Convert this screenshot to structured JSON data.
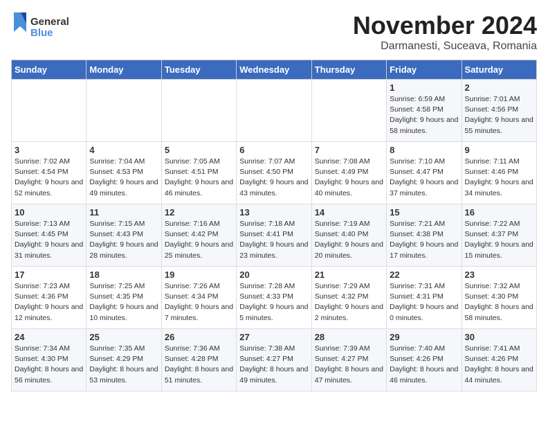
{
  "logo": {
    "line1": "General",
    "line2": "Blue"
  },
  "title": "November 2024",
  "location": "Darmanesti, Suceava, Romania",
  "days_of_week": [
    "Sunday",
    "Monday",
    "Tuesday",
    "Wednesday",
    "Thursday",
    "Friday",
    "Saturday"
  ],
  "weeks": [
    [
      {
        "day": "",
        "info": ""
      },
      {
        "day": "",
        "info": ""
      },
      {
        "day": "",
        "info": ""
      },
      {
        "day": "",
        "info": ""
      },
      {
        "day": "",
        "info": ""
      },
      {
        "day": "1",
        "info": "Sunrise: 6:59 AM\nSunset: 4:58 PM\nDaylight: 9 hours and 58 minutes."
      },
      {
        "day": "2",
        "info": "Sunrise: 7:01 AM\nSunset: 4:56 PM\nDaylight: 9 hours and 55 minutes."
      }
    ],
    [
      {
        "day": "3",
        "info": "Sunrise: 7:02 AM\nSunset: 4:54 PM\nDaylight: 9 hours and 52 minutes."
      },
      {
        "day": "4",
        "info": "Sunrise: 7:04 AM\nSunset: 4:53 PM\nDaylight: 9 hours and 49 minutes."
      },
      {
        "day": "5",
        "info": "Sunrise: 7:05 AM\nSunset: 4:51 PM\nDaylight: 9 hours and 46 minutes."
      },
      {
        "day": "6",
        "info": "Sunrise: 7:07 AM\nSunset: 4:50 PM\nDaylight: 9 hours and 43 minutes."
      },
      {
        "day": "7",
        "info": "Sunrise: 7:08 AM\nSunset: 4:49 PM\nDaylight: 9 hours and 40 minutes."
      },
      {
        "day": "8",
        "info": "Sunrise: 7:10 AM\nSunset: 4:47 PM\nDaylight: 9 hours and 37 minutes."
      },
      {
        "day": "9",
        "info": "Sunrise: 7:11 AM\nSunset: 4:46 PM\nDaylight: 9 hours and 34 minutes."
      }
    ],
    [
      {
        "day": "10",
        "info": "Sunrise: 7:13 AM\nSunset: 4:45 PM\nDaylight: 9 hours and 31 minutes."
      },
      {
        "day": "11",
        "info": "Sunrise: 7:15 AM\nSunset: 4:43 PM\nDaylight: 9 hours and 28 minutes."
      },
      {
        "day": "12",
        "info": "Sunrise: 7:16 AM\nSunset: 4:42 PM\nDaylight: 9 hours and 25 minutes."
      },
      {
        "day": "13",
        "info": "Sunrise: 7:18 AM\nSunset: 4:41 PM\nDaylight: 9 hours and 23 minutes."
      },
      {
        "day": "14",
        "info": "Sunrise: 7:19 AM\nSunset: 4:40 PM\nDaylight: 9 hours and 20 minutes."
      },
      {
        "day": "15",
        "info": "Sunrise: 7:21 AM\nSunset: 4:38 PM\nDaylight: 9 hours and 17 minutes."
      },
      {
        "day": "16",
        "info": "Sunrise: 7:22 AM\nSunset: 4:37 PM\nDaylight: 9 hours and 15 minutes."
      }
    ],
    [
      {
        "day": "17",
        "info": "Sunrise: 7:23 AM\nSunset: 4:36 PM\nDaylight: 9 hours and 12 minutes."
      },
      {
        "day": "18",
        "info": "Sunrise: 7:25 AM\nSunset: 4:35 PM\nDaylight: 9 hours and 10 minutes."
      },
      {
        "day": "19",
        "info": "Sunrise: 7:26 AM\nSunset: 4:34 PM\nDaylight: 9 hours and 7 minutes."
      },
      {
        "day": "20",
        "info": "Sunrise: 7:28 AM\nSunset: 4:33 PM\nDaylight: 9 hours and 5 minutes."
      },
      {
        "day": "21",
        "info": "Sunrise: 7:29 AM\nSunset: 4:32 PM\nDaylight: 9 hours and 2 minutes."
      },
      {
        "day": "22",
        "info": "Sunrise: 7:31 AM\nSunset: 4:31 PM\nDaylight: 9 hours and 0 minutes."
      },
      {
        "day": "23",
        "info": "Sunrise: 7:32 AM\nSunset: 4:30 PM\nDaylight: 8 hours and 58 minutes."
      }
    ],
    [
      {
        "day": "24",
        "info": "Sunrise: 7:34 AM\nSunset: 4:30 PM\nDaylight: 8 hours and 56 minutes."
      },
      {
        "day": "25",
        "info": "Sunrise: 7:35 AM\nSunset: 4:29 PM\nDaylight: 8 hours and 53 minutes."
      },
      {
        "day": "26",
        "info": "Sunrise: 7:36 AM\nSunset: 4:28 PM\nDaylight: 8 hours and 51 minutes."
      },
      {
        "day": "27",
        "info": "Sunrise: 7:38 AM\nSunset: 4:27 PM\nDaylight: 8 hours and 49 minutes."
      },
      {
        "day": "28",
        "info": "Sunrise: 7:39 AM\nSunset: 4:27 PM\nDaylight: 8 hours and 47 minutes."
      },
      {
        "day": "29",
        "info": "Sunrise: 7:40 AM\nSunset: 4:26 PM\nDaylight: 8 hours and 46 minutes."
      },
      {
        "day": "30",
        "info": "Sunrise: 7:41 AM\nSunset: 4:26 PM\nDaylight: 8 hours and 44 minutes."
      }
    ]
  ]
}
